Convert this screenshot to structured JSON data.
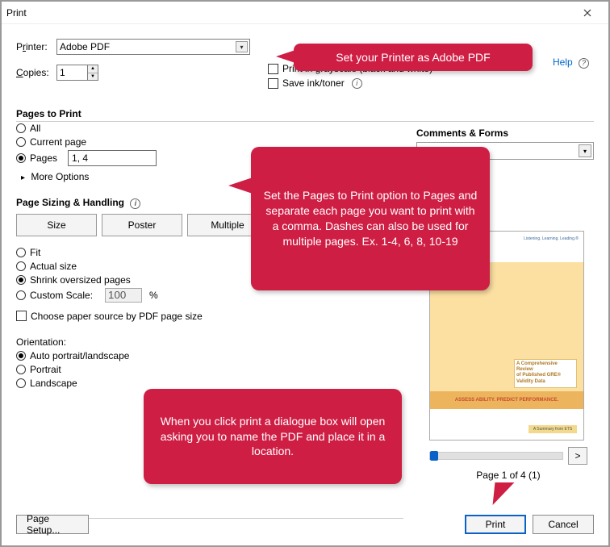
{
  "window": {
    "title": "Print"
  },
  "printer": {
    "label_pre": "P",
    "label_ul": "r",
    "label_post": "inter:",
    "value": "Adobe PDF"
  },
  "copies": {
    "label_pre": "",
    "label_ul": "C",
    "label_post": "opies:",
    "value": "1"
  },
  "right_opts": {
    "grayscale": "Print in grayscale (black and white)",
    "save_ink": "Save ink/toner"
  },
  "help": "Help",
  "pages_to_print": {
    "heading": "Pages to Print",
    "all_pre": "",
    "all_ul": "A",
    "all_post": "ll",
    "current_pre": "C",
    "current_ul": "u",
    "current_post": "rrent page",
    "pages": "Pages",
    "pages_value": "1, 4",
    "more": "More Options"
  },
  "sizing": {
    "heading": "Page Sizing & Handling",
    "size_pre": "S",
    "size_ul": "i",
    "size_post": "ze",
    "poster": "Poster",
    "multiple": "Multiple",
    "fit_pre": "",
    "fit_ul": "F",
    "fit_post": "it",
    "actual_pre": "",
    "actual_ul": "A",
    "actual_post": "ctual size",
    "shrink_pre": "",
    "shrink_ul": "S",
    "shrink_post": "hrink oversized pages",
    "custom": "Custom Scale:",
    "scale_value": "100",
    "choose_source": "Choose paper source by PDF page size"
  },
  "orientation": {
    "heading": "Orientation:",
    "auto_pre": "Au",
    "auto_ul": "t",
    "auto_post": "o portrait/landscape",
    "portrait_pre": "P",
    "portrait_ul": "o",
    "portrait_post": "rtrait",
    "landscape_pre": "",
    "landscape_ul": "L",
    "landscape_post": "andscape"
  },
  "comments": {
    "heading": "Comments & Forms"
  },
  "preview": {
    "caption1": "A Comprehensive Review",
    "caption2": "of Published GRE®",
    "caption3": "Validity Data",
    "band": "ASSESS ABILITY. PREDICT PERFORMANCE.",
    "logo": "Listening. Learning. Leading.®",
    "summary": "A Summary from ETS",
    "page_indicator": "Page 1 of 4 (1)",
    "pager": ">"
  },
  "buttons": {
    "page_setup": "Page Setup...",
    "print": "Print",
    "cancel": "Cancel"
  },
  "callouts": {
    "c1": "Set your Printer as Adobe PDF",
    "c2": "Set the Pages to Print option to Pages and separate each page you want to print with a comma. Dashes can also be used for multiple pages.\nEx. 1-4, 6, 8, 10-19",
    "c3": "When you click print a dialogue box will open asking you to name the PDF and place it in a location."
  }
}
